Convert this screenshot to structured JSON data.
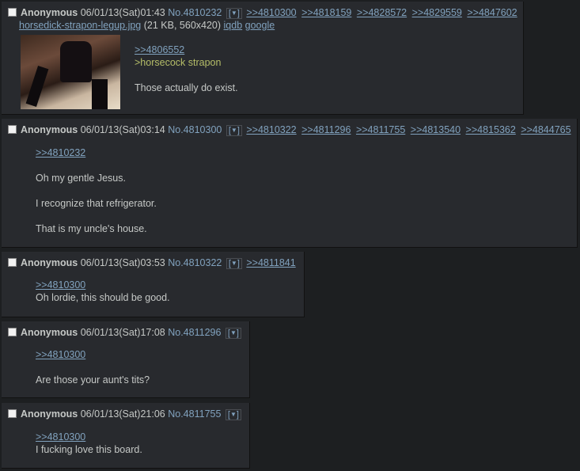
{
  "posts": [
    {
      "name": "Anonymous",
      "date": "06/01/13(Sat)01:43",
      "no": "No.4810232",
      "menu": "▼",
      "backlinks": [
        ">>4810300",
        ">>4818159",
        ">>4828572",
        ">>4829559",
        ">>4847602"
      ],
      "file": {
        "name": "horsedick-strapon-legup.jpg",
        "meta": "(21 KB, 560x420)",
        "iqdb": "iqdb",
        "google": "google"
      },
      "lines": [
        ">>4806552",
        ">horsecock strapon",
        "Those actually do exist."
      ]
    },
    {
      "name": "Anonymous",
      "date": "06/01/13(Sat)03:14",
      "no": "No.4810300",
      "menu": "▼",
      "backlinks": [
        ">>4810322",
        ">>4811296",
        ">>4811755",
        ">>4813540",
        ">>4815362",
        ">>4844765"
      ],
      "lines": [
        ">>4810232",
        "Oh my gentle Jesus.",
        "I recognize that refrigerator.",
        "That is my uncle's house."
      ]
    },
    {
      "name": "Anonymous",
      "date": "06/01/13(Sat)03:53",
      "no": "No.4810322",
      "menu": "▼",
      "backlinks": [
        ">>4811841"
      ],
      "lines": [
        ">>4810300",
        "Oh lordie, this should be good."
      ]
    },
    {
      "name": "Anonymous",
      "date": "06/01/13(Sat)17:08",
      "no": "No.4811296",
      "menu": "▼",
      "backlinks": [],
      "lines": [
        ">>4810300",
        "Are those your aunt's tits?"
      ]
    },
    {
      "name": "Anonymous",
      "date": "06/01/13(Sat)21:06",
      "no": "No.4811755",
      "menu": "▼",
      "backlinks": [],
      "lines": [
        ">>4810300",
        "I fucking love this board."
      ]
    }
  ]
}
